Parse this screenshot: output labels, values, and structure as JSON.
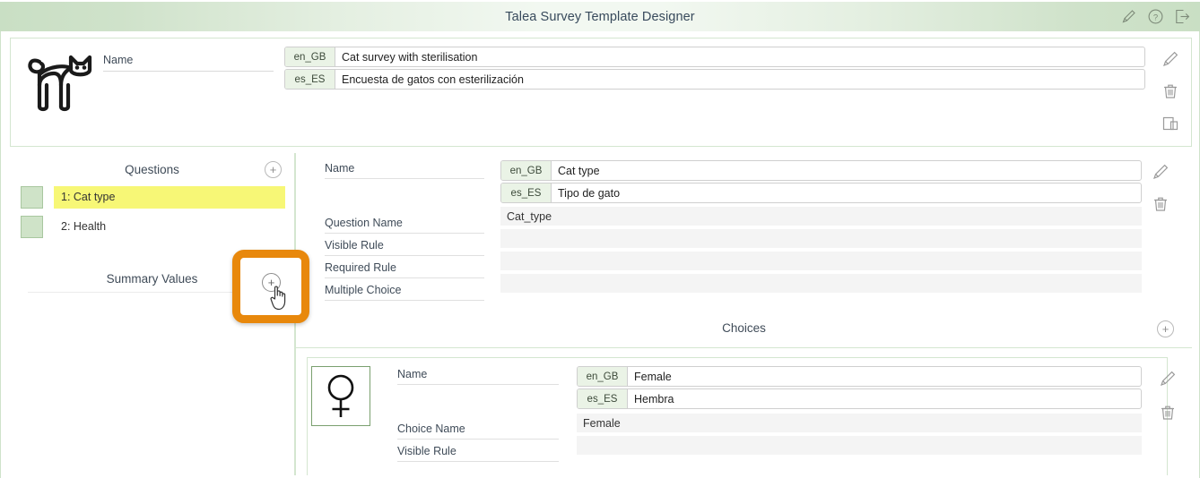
{
  "titlebar": {
    "title": "Talea Survey Template Designer",
    "actions": [
      {
        "name": "edit-icon",
        "label": "Edit"
      },
      {
        "name": "help-icon",
        "label": "Help"
      },
      {
        "name": "logout-icon",
        "label": "Log out"
      }
    ]
  },
  "survey": {
    "icon": "cat-icon",
    "name_label": "Name",
    "translations": [
      {
        "lang": "en_GB",
        "value": "Cat survey with sterilisation"
      },
      {
        "lang": "es_ES",
        "value": "Encuesta de gatos con esterilización"
      }
    ],
    "actions": [
      {
        "name": "edit-icon"
      },
      {
        "name": "delete-icon"
      },
      {
        "name": "duplicate-icon"
      }
    ]
  },
  "questions_panel": {
    "title": "Questions",
    "add_label": "+",
    "items": [
      {
        "label": "1: Cat type",
        "selected": true
      },
      {
        "label": "2: Health",
        "selected": false
      }
    ]
  },
  "summary_panel": {
    "title": "Summary Values",
    "add_label": "+"
  },
  "callout": {
    "highlight_color": "#e8880c",
    "add_label": "+"
  },
  "question_detail": {
    "labels": {
      "name": "Name",
      "question_name": "Question Name",
      "visible_rule": "Visible Rule",
      "required_rule": "Required Rule",
      "multiple_choice": "Multiple Choice"
    },
    "translations": [
      {
        "lang": "en_GB",
        "value": "Cat type"
      },
      {
        "lang": "es_ES",
        "value": "Tipo de gato"
      }
    ],
    "values": {
      "question_name": "Cat_type",
      "visible_rule": "",
      "required_rule": "",
      "multiple_choice": ""
    },
    "actions": [
      {
        "name": "edit-icon"
      },
      {
        "name": "delete-icon"
      }
    ]
  },
  "choices_panel": {
    "title": "Choices",
    "add_label": "+",
    "choice": {
      "icon": "female-symbol-icon",
      "labels": {
        "name": "Name",
        "choice_name": "Choice Name",
        "visible_rule": "Visible Rule"
      },
      "translations": [
        {
          "lang": "en_GB",
          "value": "Female"
        },
        {
          "lang": "es_ES",
          "value": "Hembra"
        }
      ],
      "values": {
        "choice_name": "Female",
        "visible_rule": ""
      },
      "actions": [
        {
          "name": "edit-icon"
        },
        {
          "name": "delete-icon"
        }
      ]
    }
  }
}
